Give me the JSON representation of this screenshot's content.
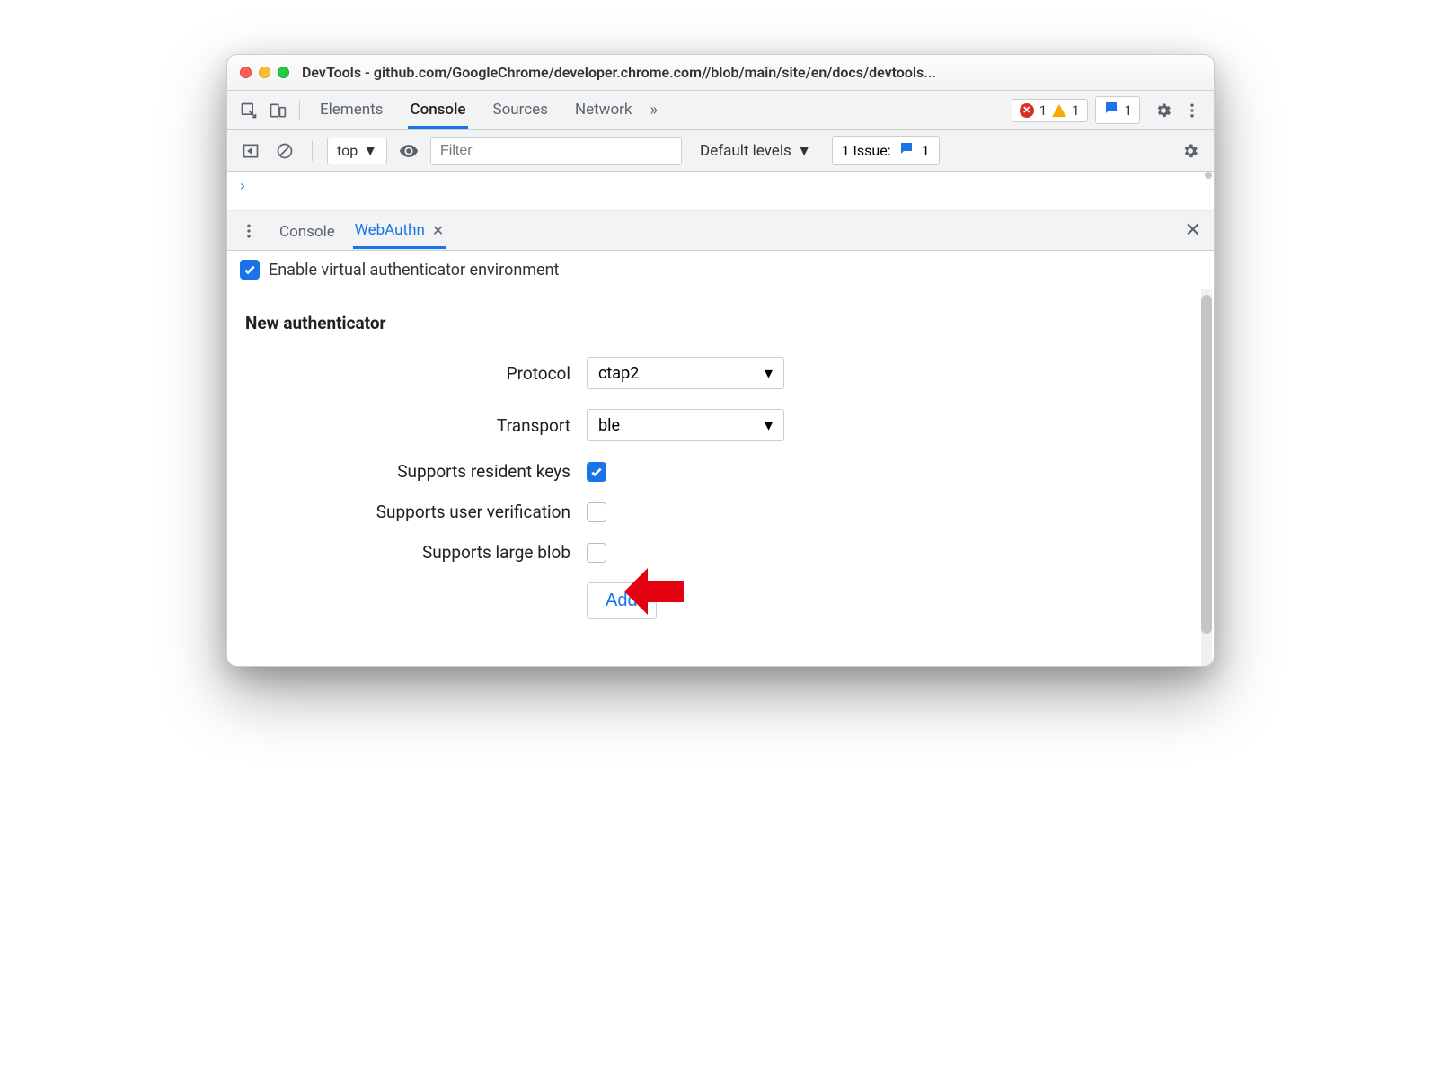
{
  "window": {
    "title": "DevTools - github.com/GoogleChrome/developer.chrome.com//blob/main/site/en/docs/devtools..."
  },
  "main_tabs": {
    "elements": "Elements",
    "console": "Console",
    "sources": "Sources",
    "network": "Network"
  },
  "badges": {
    "errors": "1",
    "warnings": "1",
    "messages": "1"
  },
  "console_toolbar": {
    "context": "top",
    "filter_placeholder": "Filter",
    "levels": "Default levels",
    "issues_label": "1 Issue:",
    "issues_count": "1"
  },
  "drawer": {
    "tabs": {
      "console": "Console",
      "webauthn": "WebAuthn"
    },
    "enable_label": "Enable virtual authenticator environment"
  },
  "form": {
    "heading": "New authenticator",
    "protocol_label": "Protocol",
    "protocol_value": "ctap2",
    "transport_label": "Transport",
    "transport_value": "ble",
    "resident_keys_label": "Supports resident keys",
    "user_verification_label": "Supports user verification",
    "large_blob_label": "Supports large blob",
    "add_button": "Add",
    "resident_keys_checked": true,
    "user_verification_checked": false,
    "large_blob_checked": false
  }
}
